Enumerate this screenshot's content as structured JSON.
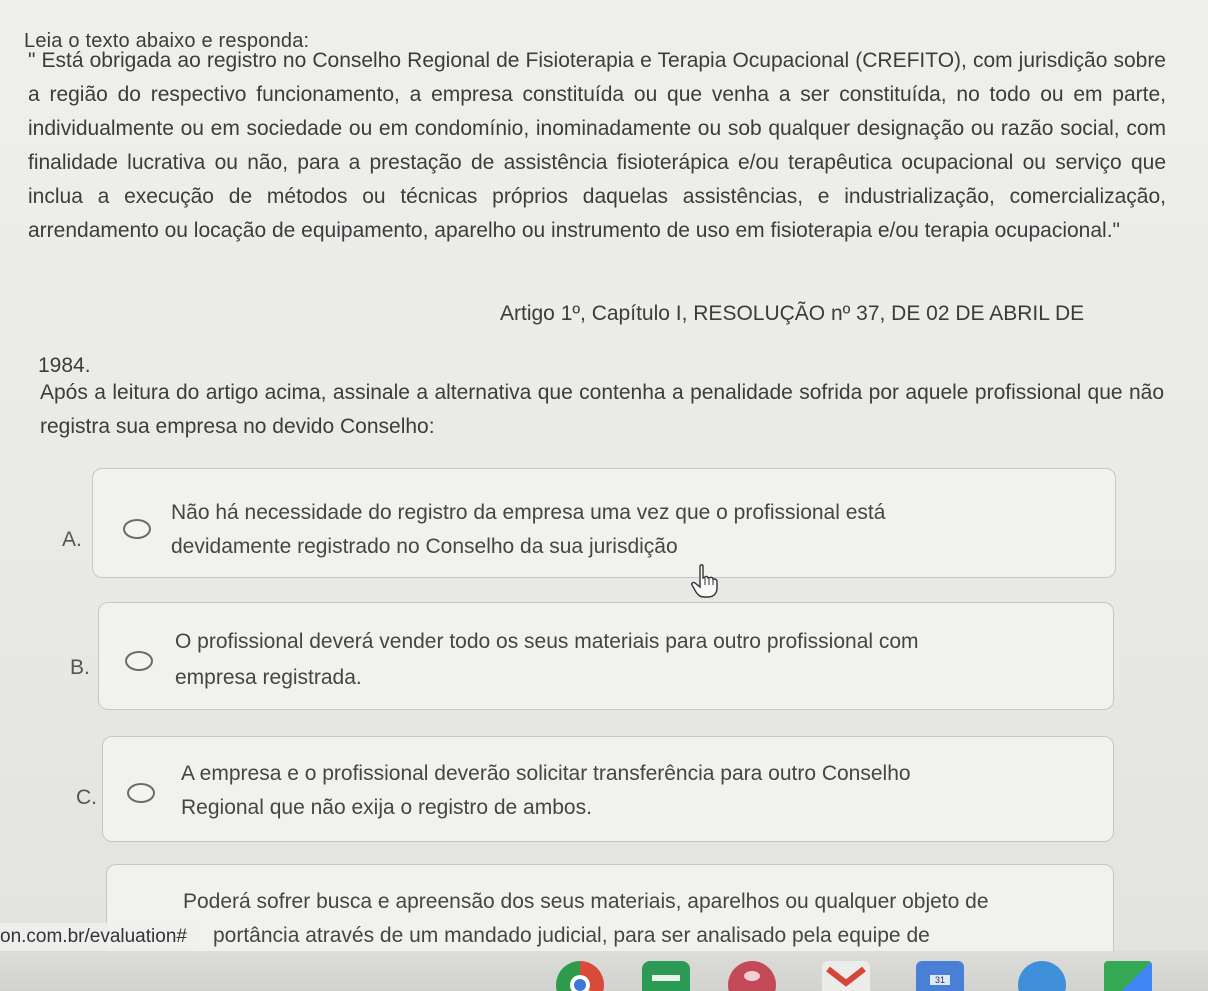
{
  "intro": "Leia o texto abaixo e responda:",
  "quote": "\" Está obrigada ao registro no Conselho Regional de Fisioterapia e Terapia Ocupacional (CREFITO), com jurisdição sobre a região do respectivo funcionamento, a empresa constituída ou que venha a ser constituída, no todo ou em parte, individualmente ou em sociedade ou em condomínio, inominadamente ou sob qualquer designação ou razão social, com finalidade lucrativa ou não, para a prestação de assistência fisioterápica e/ou terapêutica ocupacional ou serviço que inclua a execução de métodos ou técnicas próprios daquelas assistências, e industrialização, comercialização, arrendamento ou locação de equipamento, aparelho ou instrumento de uso em fisioterapia e/ou terapia ocupacional.\"",
  "citation": "Artigo 1º, Capítulo I, RESOLUÇÃO nº 37, DE 02 DE ABRIL DE",
  "year": "1984.",
  "question": "Após a leitura do artigo acima, assinale a alternativa que contenha a penalidade sofrida por aquele profissional que não registra sua empresa no devido Conselho:",
  "options": [
    {
      "letter": "A.",
      "line1": "Não há necessidade do registro da empresa uma vez que o profissional está",
      "line2": "devidamente registrado no Conselho da sua jurisdição"
    },
    {
      "letter": "B.",
      "line1": "O profissional deverá vender todo os seus materiais para outro profissional com",
      "line2": "empresa registrada."
    },
    {
      "letter": "C.",
      "line1": "A empresa e o profissional deverão solicitar transferência para outro Conselho",
      "line2": "Regional que não exija o registro de ambos."
    },
    {
      "letter": "",
      "line1": "Poderá sofrer busca e apreensão dos seus materiais, aparelhos ou qualquer objeto de",
      "line2": "portância através de um mandado judicial, para ser analisado pela equipe de"
    }
  ],
  "status_url": "on.com.br/evaluation#",
  "taskbar": {
    "icons": [
      "chrome-icon",
      "classroom-icon",
      "photos-icon",
      "gmail-icon",
      "calendar-icon",
      "files-icon",
      "play-store-icon"
    ]
  },
  "colors": {
    "background": "#e9e9e6",
    "text": "#3c3c3c",
    "option_border": "#c7c7c4"
  }
}
